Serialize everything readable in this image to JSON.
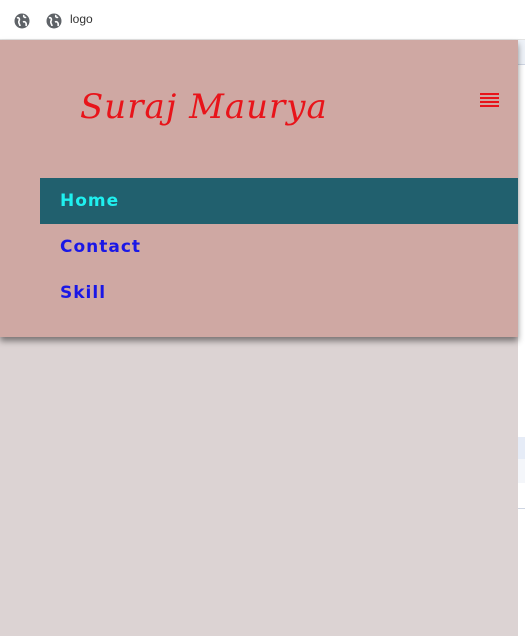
{
  "browser": {
    "tab_title": "logo"
  },
  "header": {
    "logo_text": "Suraj Maurya"
  },
  "nav": {
    "items": [
      {
        "label": "Home",
        "active": true
      },
      {
        "label": "Contact",
        "active": false
      },
      {
        "label": "Skill",
        "active": false
      }
    ]
  },
  "colors": {
    "panel_bg": "#cfa8a3",
    "logo": "#e8141a",
    "active_bg": "#21606e",
    "active_text": "#1ff0ef",
    "link": "#1a17e6",
    "page_bg": "#dcd3d3"
  },
  "icons": {
    "browser_left": "globe-icon",
    "tab": "globe-icon",
    "menu": "hamburger-menu-icon"
  }
}
